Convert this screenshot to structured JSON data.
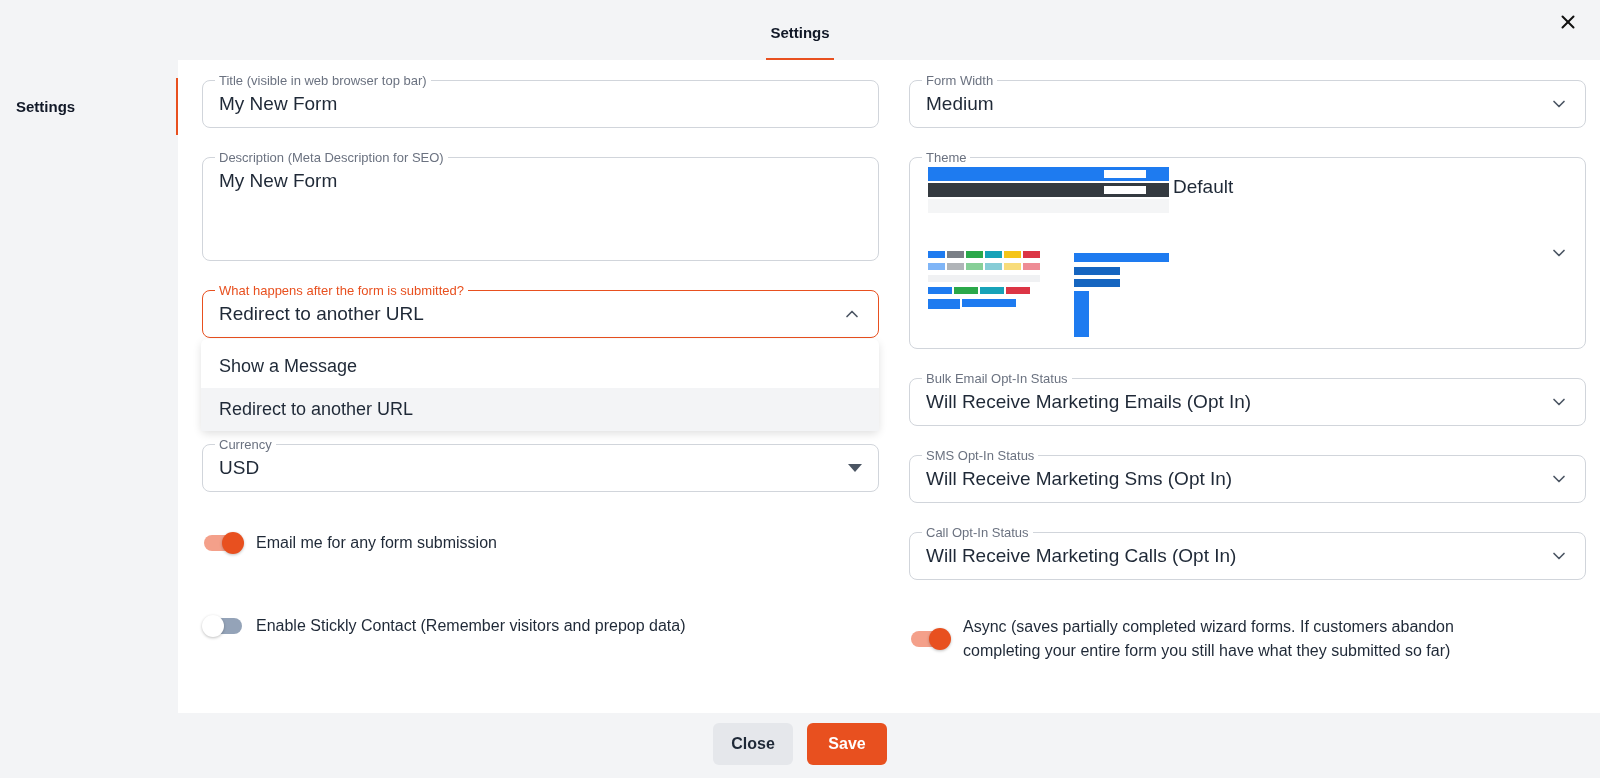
{
  "header": {
    "tabs": [
      {
        "label": "Settings",
        "selected": true
      }
    ]
  },
  "sidebar": {
    "items": [
      {
        "label": "Settings",
        "selected": true
      }
    ]
  },
  "left_fields": [
    {
      "kind": "text",
      "label": "Title (visible in web browser top bar)",
      "value": "My New Form"
    },
    {
      "kind": "textarea",
      "label": "Description (Meta Description for SEO)",
      "value": "My New Form"
    },
    {
      "kind": "select",
      "label": "What happens after the form is submitted?",
      "value": "Redirect to another URL",
      "expanded": true,
      "options": [
        {
          "label": "Show a Message",
          "selected": false
        },
        {
          "label": "Redirect to another URL",
          "selected": true
        }
      ]
    },
    {
      "kind": "native-select",
      "label": "Currency",
      "value": "USD",
      "expanded": false
    }
  ],
  "left_toggles": [
    {
      "label": "Email me for any form submission",
      "on": true
    },
    {
      "label": "Enable Stickly Contact (Remember visitors and prepop data)",
      "on": false
    }
  ],
  "right_fields": [
    {
      "kind": "select",
      "label": "Form Width",
      "value": "Medium",
      "expanded": false
    },
    {
      "kind": "theme",
      "label": "Theme",
      "value": "Default",
      "expanded": false
    },
    {
      "kind": "select",
      "label": "Bulk Email Opt-In Status",
      "value": "Will Receive Marketing Emails (Opt In)",
      "expanded": false
    },
    {
      "kind": "select",
      "label": "SMS Opt-In Status",
      "value": "Will Receive Marketing Sms (Opt In)",
      "expanded": false
    },
    {
      "kind": "select",
      "label": "Call Opt-In Status",
      "value": "Will Receive Marketing Calls (Opt In)",
      "expanded": false
    }
  ],
  "right_toggles": [
    {
      "label": "Async (saves partially completed wizard forms. If customers abandon completing your entire form you still have what they submitted so far)",
      "on": true
    }
  ],
  "footer": {
    "buttons": [
      {
        "label": "Close",
        "kind": "secondary"
      },
      {
        "label": "Save",
        "kind": "primary"
      }
    ]
  }
}
